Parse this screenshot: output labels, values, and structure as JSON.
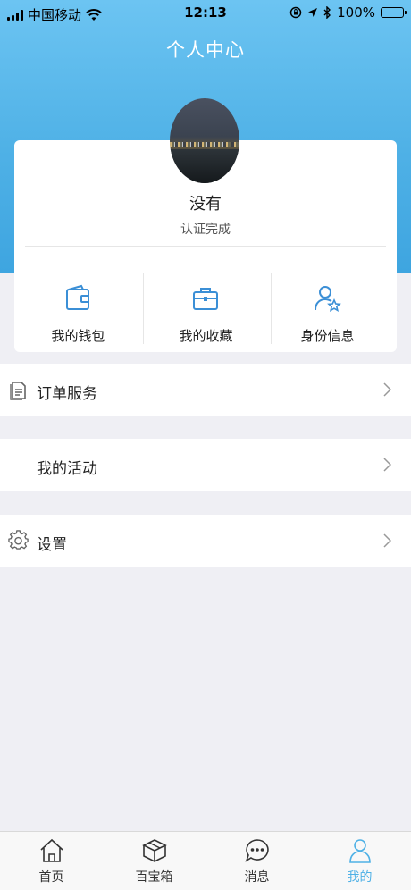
{
  "status_bar": {
    "carrier": "中国移动",
    "time": "12:13",
    "battery": "100%"
  },
  "header": {
    "title": "个人中心"
  },
  "profile": {
    "name": "没有",
    "status": "认证完成"
  },
  "quick_actions": [
    {
      "label": "我的钱包",
      "icon": "wallet-icon"
    },
    {
      "label": "我的收藏",
      "icon": "briefcase-icon"
    },
    {
      "label": "身份信息",
      "icon": "user-star-icon"
    }
  ],
  "menu": [
    {
      "label": "订单服务",
      "icon": "document-icon"
    },
    {
      "label": "我的活动",
      "icon": ""
    },
    {
      "label": "设置",
      "icon": "gear-icon"
    }
  ],
  "tabbar": {
    "items": [
      {
        "label": "首页",
        "icon": "home-icon"
      },
      {
        "label": "百宝箱",
        "icon": "box-icon"
      },
      {
        "label": "消息",
        "icon": "chat-bubble-icon"
      },
      {
        "label": "我的",
        "icon": "person-icon"
      }
    ],
    "active_index": 3
  },
  "colors": {
    "accent": "#4fb1e6",
    "header_gradient_top": "#6cc4f2",
    "page_bg": "#efeff4",
    "icon_blue": "#3b8fd6"
  }
}
